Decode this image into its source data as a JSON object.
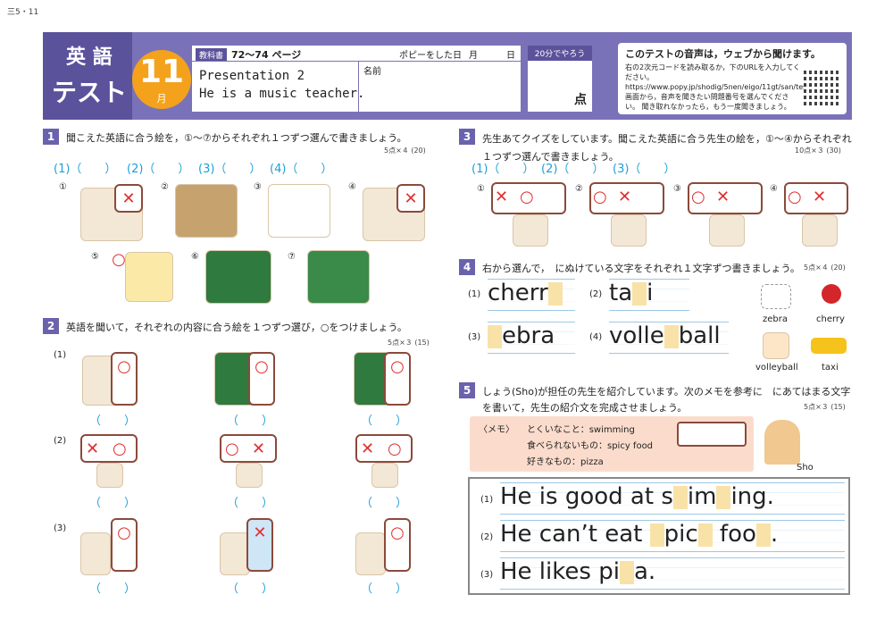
{
  "code": "三5・11",
  "header": {
    "subject_line1": "英 語",
    "subject_line2": "テスト",
    "month_num": "11",
    "month_unit": "月",
    "tag": "教科書",
    "pages": "72〜74 ページ",
    "did_label": "ポピーをした日",
    "month_label": "月",
    "day_label": "日",
    "lesson": "Presentation 2",
    "sentence": "He is a music teacher.",
    "name_label": "名前",
    "time": "20分でやろう",
    "score_unit": "点",
    "audio_title": "このテストの音声は，ウェブから聞けます。",
    "audio_text": "右の2次元コードを読み取るか，下のURLを入力してください。 https://www.popy.jp/shodig/5nen/eigo/11gt/san/test/ 画面から，音声を聞きたい問題番号を選んでください。 聞き取れなかったら，もう一度聞きましょう。"
  },
  "s1": {
    "num": "1",
    "q": "聞こえた英語に合う絵を，①〜⑦からそれぞれ１つずつ選んで書きましょう。",
    "pts": "5点×４ (20)",
    "blanks": [
      "(1)（　　）",
      "(2)（　　）",
      "(3)（　　）",
      "(4)（　　）"
    ],
    "pics": [
      "①",
      "②",
      "③",
      "④",
      "⑤",
      "⑥",
      "⑦"
    ]
  },
  "s2": {
    "num": "2",
    "q": "英語を聞いて，それぞれの内容に合う絵を１つずつ選び，○をつけましょう。",
    "pts": "5点×３ (15)",
    "rows": [
      "(1)",
      "(2)",
      "(3)"
    ],
    "paren": "（　　）"
  },
  "s3": {
    "num": "3",
    "q": "先生あてクイズをしています。聞こえた英語に合う先生の絵を，①〜④からそれぞれ１つずつ選んで書きましょう。",
    "pts": "10点×３ (30)",
    "blanks": [
      "(1)（　　）",
      "(2)（　　）",
      "(3)（　　）"
    ],
    "pics": [
      "①",
      "②",
      "③",
      "④"
    ]
  },
  "s4": {
    "num": "4",
    "q": "右から選んで，　にぬけている文字をそれぞれ１文字ずつ書きましょう。",
    "pts": "5点×４ (20)",
    "items": [
      {
        "n": "(1)",
        "a": "cherr",
        "b": ""
      },
      {
        "n": "(2)",
        "a": "ta",
        "b": "i"
      },
      {
        "n": "(3)",
        "a": "",
        "b": "ebra"
      },
      {
        "n": "(4)",
        "a": "volle",
        "b": "ball"
      }
    ],
    "words": [
      "zebra",
      "cherry",
      "volleyball",
      "taxi"
    ]
  },
  "s5": {
    "num": "5",
    "q": "しょう(Sho)が担任の先生を紹介しています。次のメモを参考に　にあてはまる文字を書いて，先生の紹介文を完成させましょう。",
    "pts": "5点×３ (15)",
    "memo_title": "〈メモ〉",
    "memo1": "とくいなこと：swimming",
    "memo2": "食べられないもの：spicy food",
    "memo3": "好きなもの：pizza",
    "sho": "Sho",
    "lines": [
      {
        "n": "(1)",
        "parts": [
          "He is good at s",
          "im",
          "ing."
        ]
      },
      {
        "n": "(2)",
        "parts": [
          "He can’t eat ",
          "pic",
          " foo",
          "."
        ]
      },
      {
        "n": "(3)",
        "parts": [
          "He likes pi",
          "a."
        ]
      }
    ]
  }
}
